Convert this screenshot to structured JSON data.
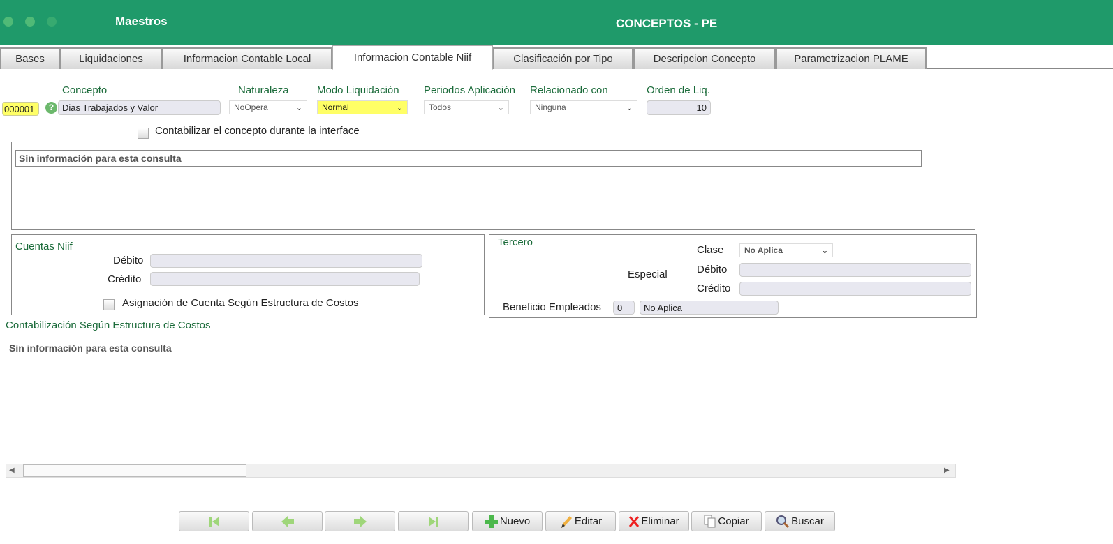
{
  "header": {
    "section": "Maestros",
    "title": "CONCEPTOS - PE"
  },
  "tabs": [
    "Bases",
    "Liquidaciones",
    "Informacion Contable Local",
    "Informacion Contable Niif",
    "Clasificación por Tipo",
    "Descripcion Concepto",
    "Parametrizacion PLAME"
  ],
  "form": {
    "concepto_label": "Concepto",
    "code": "000001",
    "concepto_value": "Dias Trabajados y Valor",
    "naturaleza_label": "Naturaleza",
    "naturaleza_value": "NoOpera",
    "modo_label": "Modo Liquidación",
    "modo_value": "Normal",
    "periodos_label": "Periodos Aplicación",
    "periodos_value": "Todos",
    "relacionado_label": "Relacionado con",
    "relacionado_value": "Ninguna",
    "orden_label": "Orden de Liq.",
    "orden_value": "10",
    "contabilizar_label": "Contabilizar el concepto durante la interface"
  },
  "grid1": {
    "empty": "Sin información para esta consulta"
  },
  "cuentas": {
    "title": "Cuentas Niif",
    "debito": "Débito",
    "credito": "Crédito",
    "asignacion": "Asignación de Cuenta Según Estructura de Costos"
  },
  "tercero": {
    "title": "Tercero",
    "clase": "Clase",
    "clase_value": "No Aplica",
    "especial": "Especial",
    "debito": "Débito",
    "credito": "Crédito",
    "beneficio": "Beneficio Empleados",
    "beneficio_code": "0",
    "beneficio_value": "No Aplica"
  },
  "estructura": {
    "title": "Contabilización Según Estructura de Costos",
    "empty": "Sin información para esta consulta"
  },
  "toolbar": {
    "nuevo": "Nuevo",
    "editar": "Editar",
    "eliminar": "Eliminar",
    "copiar": "Copiar",
    "buscar": "Buscar"
  },
  "colors": {
    "brand": "#1f9a6a",
    "label": "#1b6b3a",
    "highlight": "#ffff66"
  }
}
